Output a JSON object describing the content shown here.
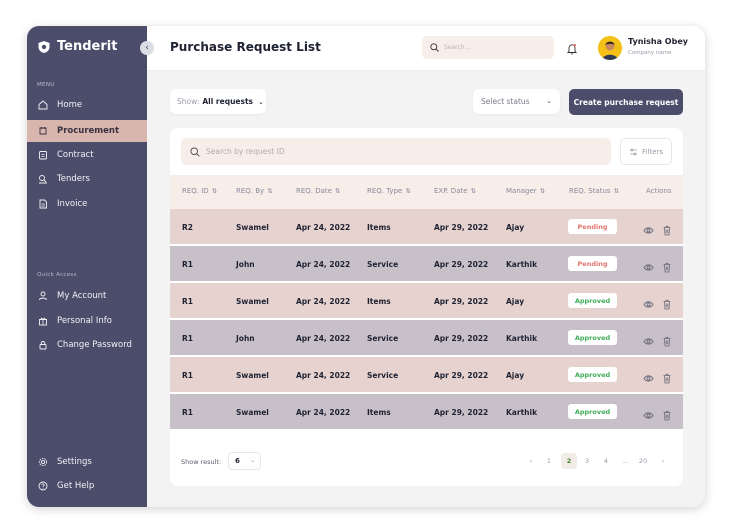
{
  "app": {
    "name": "Tenderit",
    "collapse_glyph": "‹"
  },
  "sidebar": {
    "menu_title": "MENU",
    "menu_items": [
      {
        "label": "Home",
        "icon": "home-icon",
        "active": false
      },
      {
        "label": "Procurement",
        "icon": "procurement-icon",
        "active": true
      },
      {
        "label": "Contract",
        "icon": "contract-icon",
        "active": false
      },
      {
        "label": "Tenders",
        "icon": "tenders-icon",
        "active": false
      },
      {
        "label": "Invoice",
        "icon": "invoice-icon",
        "active": false
      }
    ],
    "quick_title": "Quick Access",
    "quick_items": [
      {
        "label": "My Account",
        "icon": "user-icon"
      },
      {
        "label": "Personal Info",
        "icon": "gift-icon"
      },
      {
        "label": "Change Password",
        "icon": "lock-icon"
      }
    ],
    "bottom_items": [
      {
        "label": "Settings",
        "icon": "gear-icon"
      },
      {
        "label": "Get Help",
        "icon": "help-icon"
      }
    ]
  },
  "header": {
    "title": "Purchase Request List",
    "search_placeholder": "Search...",
    "user_name": "Tynisha Obey",
    "user_role": "Company name"
  },
  "toolbar": {
    "show_label": "Show:",
    "show_value": "All requests",
    "status_placeholder": "Select status",
    "create_label": "Create purchase request"
  },
  "table": {
    "search_placeholder": "Search by request ID",
    "filters_label": "Filters",
    "columns": [
      "REQ. ID",
      "REQ. By",
      "REQ. Date",
      "REQ. Type",
      "EXP. Date",
      "Manager",
      "REQ. Status",
      "Actions"
    ],
    "rows": [
      {
        "id": "R2",
        "by": "Swamel",
        "req_date": "Apr 24, 2022",
        "type": "Items",
        "exp_date": "Apr 29, 2022",
        "manager": "Ajay",
        "status": "Pending"
      },
      {
        "id": "R1",
        "by": "John",
        "req_date": "Apr 24, 2022",
        "type": "Service",
        "exp_date": "Apr 29, 2022",
        "manager": "Karthik",
        "status": "Pending"
      },
      {
        "id": "R1",
        "by": "Swamel",
        "req_date": "Apr 24, 2022",
        "type": "Items",
        "exp_date": "Apr 29, 2022",
        "manager": "Ajay",
        "status": "Approved"
      },
      {
        "id": "R1",
        "by": "John",
        "req_date": "Apr 24, 2022",
        "type": "Service",
        "exp_date": "Apr 29, 2022",
        "manager": "Karthik",
        "status": "Approved"
      },
      {
        "id": "R1",
        "by": "Swamel",
        "req_date": "Apr 24, 2022",
        "type": "Service",
        "exp_date": "Apr 29, 2022",
        "manager": "Ajay",
        "status": "Approved"
      },
      {
        "id": "R1",
        "by": "Swamel",
        "req_date": "Apr 24, 2022",
        "type": "Items",
        "exp_date": "Apr 29, 2022",
        "manager": "Karthik",
        "status": "Approved"
      }
    ]
  },
  "pagination": {
    "show_result_label": "Show result:",
    "per_page": "6",
    "prev": "‹",
    "pages": [
      "1",
      "2",
      "3",
      "4",
      "...",
      "20"
    ],
    "current": "2",
    "next": "›"
  },
  "colors": {
    "sidebar_bg": "#4c4d6b",
    "accent_pink": "#d8b6ae",
    "row_pink": "#e6d2ce",
    "row_gray": "#c8c0c8",
    "pending": "#e0746e",
    "approved": "#3fae58"
  }
}
